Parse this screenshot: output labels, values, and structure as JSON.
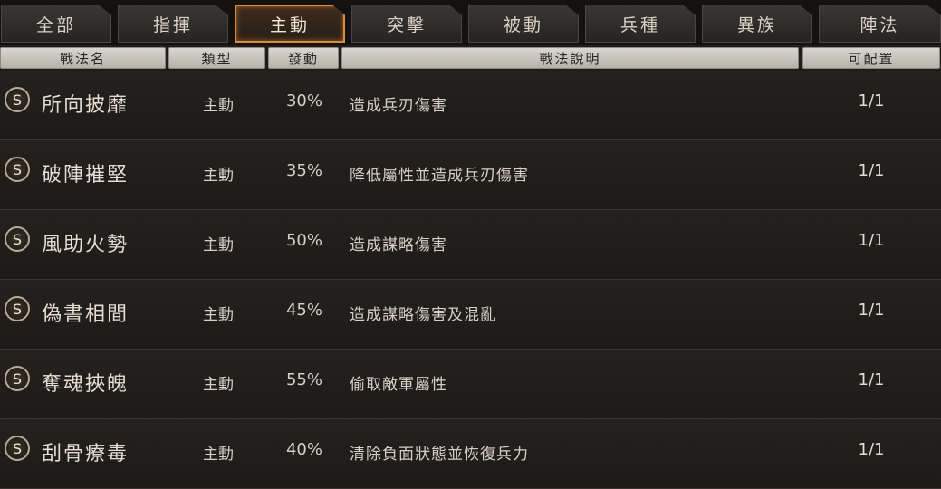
{
  "tabs": [
    {
      "label": "全部"
    },
    {
      "label": "指揮"
    },
    {
      "label": "主動"
    },
    {
      "label": "突擊"
    },
    {
      "label": "被動"
    },
    {
      "label": "兵種"
    },
    {
      "label": "異族"
    },
    {
      "label": "陣法"
    }
  ],
  "active_tab": "主動",
  "headers": {
    "name": "戰法名",
    "type": "類型",
    "rate": "發動",
    "desc": "戰法說明",
    "count": "可配置"
  },
  "rows": [
    {
      "grade": "S",
      "name": "所向披靡",
      "type": "主動",
      "rate": "30%",
      "desc": "造成兵刃傷害",
      "count": "1/1"
    },
    {
      "grade": "S",
      "name": "破陣摧堅",
      "type": "主動",
      "rate": "35%",
      "desc": "降低屬性並造成兵刃傷害",
      "count": "1/1"
    },
    {
      "grade": "S",
      "name": "風助火勢",
      "type": "主動",
      "rate": "50%",
      "desc": "造成謀略傷害",
      "count": "1/1"
    },
    {
      "grade": "S",
      "name": "偽書相間",
      "type": "主動",
      "rate": "45%",
      "desc": "造成謀略傷害及混亂",
      "count": "1/1"
    },
    {
      "grade": "S",
      "name": "奪魂挾魄",
      "type": "主動",
      "rate": "55%",
      "desc": "偷取敵軍屬性",
      "count": "1/1"
    },
    {
      "grade": "S",
      "name": "刮骨療毒",
      "type": "主動",
      "rate": "40%",
      "desc": "清除負面狀態並恢復兵力",
      "count": "1/1"
    }
  ],
  "colors": {
    "active_tab_border": "#d98a3c",
    "background": "#1f1c1a",
    "header_bg": "#c9c5bd"
  }
}
